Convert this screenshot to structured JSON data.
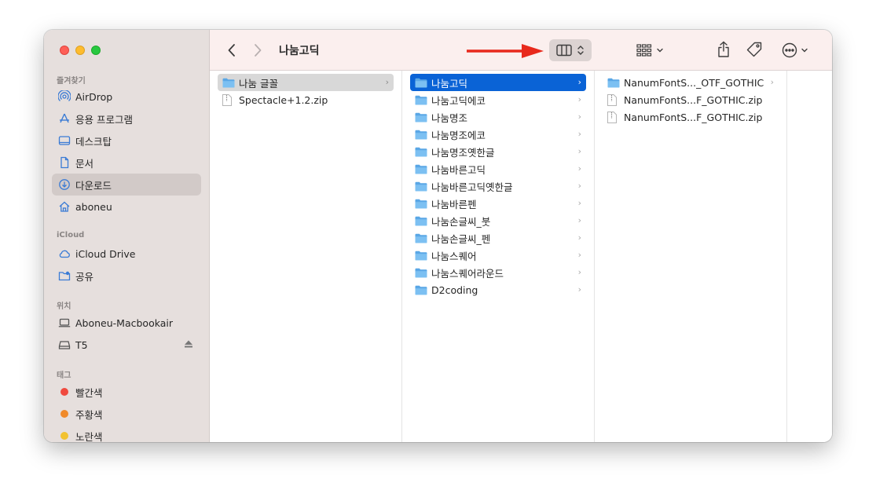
{
  "window": {
    "title": "나눔고딕"
  },
  "sidebar": {
    "favorites_header": "즐겨찾기",
    "favorites": [
      {
        "label": "AirDrop",
        "icon": "airdrop-icon"
      },
      {
        "label": "응용 프로그램",
        "icon": "applications-icon"
      },
      {
        "label": "데스크탑",
        "icon": "desktop-icon"
      },
      {
        "label": "문서",
        "icon": "document-icon"
      },
      {
        "label": "다운로드",
        "icon": "download-icon",
        "selected": true
      },
      {
        "label": "aboneu",
        "icon": "home-icon"
      }
    ],
    "icloud_header": "iCloud",
    "icloud": [
      {
        "label": "iCloud Drive",
        "icon": "cloud-icon"
      },
      {
        "label": "공유",
        "icon": "shared-folder-icon"
      }
    ],
    "locations_header": "위치",
    "locations": [
      {
        "label": "Aboneu-Macbookair",
        "icon": "laptop-icon"
      },
      {
        "label": "T5",
        "icon": "drive-icon",
        "ejectable": true
      }
    ],
    "tags_header": "태그",
    "tags": [
      {
        "label": "빨간색",
        "color": "#f04a3f"
      },
      {
        "label": "주황색",
        "color": "#f08a2a"
      },
      {
        "label": "노란색",
        "color": "#f2c230"
      }
    ]
  },
  "columns": [
    {
      "items": [
        {
          "label": "나눔 글꼴",
          "type": "folder",
          "selected": "grey"
        },
        {
          "label": "Spectacle+1.2.zip",
          "type": "file"
        }
      ]
    },
    {
      "items": [
        {
          "label": "나눔고딕",
          "type": "folder",
          "selected": "blue"
        },
        {
          "label": "나눔고딕에코",
          "type": "folder"
        },
        {
          "label": "나눔명조",
          "type": "folder"
        },
        {
          "label": "나눔명조에코",
          "type": "folder"
        },
        {
          "label": "나눔명조옛한글",
          "type": "folder"
        },
        {
          "label": "나눔바른고딕",
          "type": "folder"
        },
        {
          "label": "나눔바른고딕옛한글",
          "type": "folder"
        },
        {
          "label": "나눔바른펜",
          "type": "folder"
        },
        {
          "label": "나눔손글씨_붓",
          "type": "folder"
        },
        {
          "label": "나눔손글씨_펜",
          "type": "folder"
        },
        {
          "label": "나눔스퀘어",
          "type": "folder"
        },
        {
          "label": "나눔스퀘어라운드",
          "type": "folder"
        },
        {
          "label": "D2coding",
          "type": "folder"
        }
      ]
    },
    {
      "items": [
        {
          "label": "NanumFontS..._OTF_GOTHIC",
          "type": "folder"
        },
        {
          "label": "NanumFontS...F_GOTHIC.zip",
          "type": "file"
        },
        {
          "label": "NanumFontS...F_GOTHIC.zip",
          "type": "file"
        }
      ]
    }
  ],
  "annotation": {
    "color": "#e8291c"
  }
}
